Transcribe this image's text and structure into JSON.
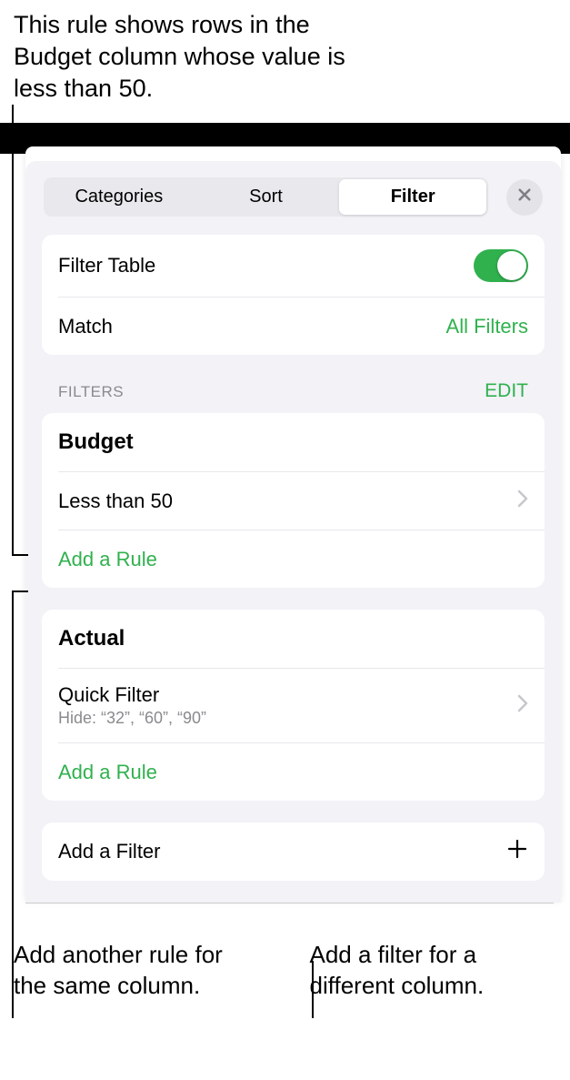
{
  "callouts": {
    "top": "This rule shows rows in the Budget column whose value is less than 50.",
    "bottom_left": "Add another rule for the same column.",
    "bottom_right": "Add a filter for a different column."
  },
  "tabs": {
    "categories": "Categories",
    "sort": "Sort",
    "filter": "Filter"
  },
  "settings": {
    "filter_table_label": "Filter Table",
    "match_label": "Match",
    "match_value": "All Filters"
  },
  "section": {
    "title": "FILTERS",
    "edit": "EDIT"
  },
  "filters": [
    {
      "column": "Budget",
      "rule": "Less than 50",
      "subtext": "",
      "add_rule": "Add a Rule"
    },
    {
      "column": "Actual",
      "rule": "Quick Filter",
      "subtext": "Hide: “32”, “60”, “90”",
      "add_rule": "Add a Rule"
    }
  ],
  "add_filter": "Add a Filter"
}
